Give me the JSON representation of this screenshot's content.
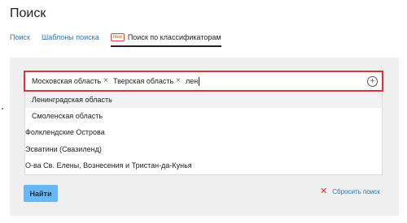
{
  "page": {
    "title": "Поиск"
  },
  "tabs": [
    {
      "label": "Поиск"
    },
    {
      "label": "Шаблоны поиска"
    },
    {
      "badge": "new",
      "label": "Поиск по классификаторам"
    }
  ],
  "search": {
    "chips": [
      {
        "label": "Московская область",
        "remove": "×"
      },
      {
        "label": "Тверская область",
        "remove": "×"
      }
    ],
    "query": "лен",
    "add_icon": "plus-circle-icon"
  },
  "suggestions": [
    "Ленинградская область",
    "Смоленская область",
    "Фолклендские Острова",
    "Эсватини (Свазиленд)",
    "О-ва Св. Елены, Вознесения и Тристан-да-Кунья"
  ],
  "actions": {
    "find_label": "Найти",
    "reset_label": "Сбросить поиск"
  },
  "colors": {
    "accent": "#2a76b8",
    "highlight": "#d9343b",
    "button": "#6ab6f0"
  }
}
